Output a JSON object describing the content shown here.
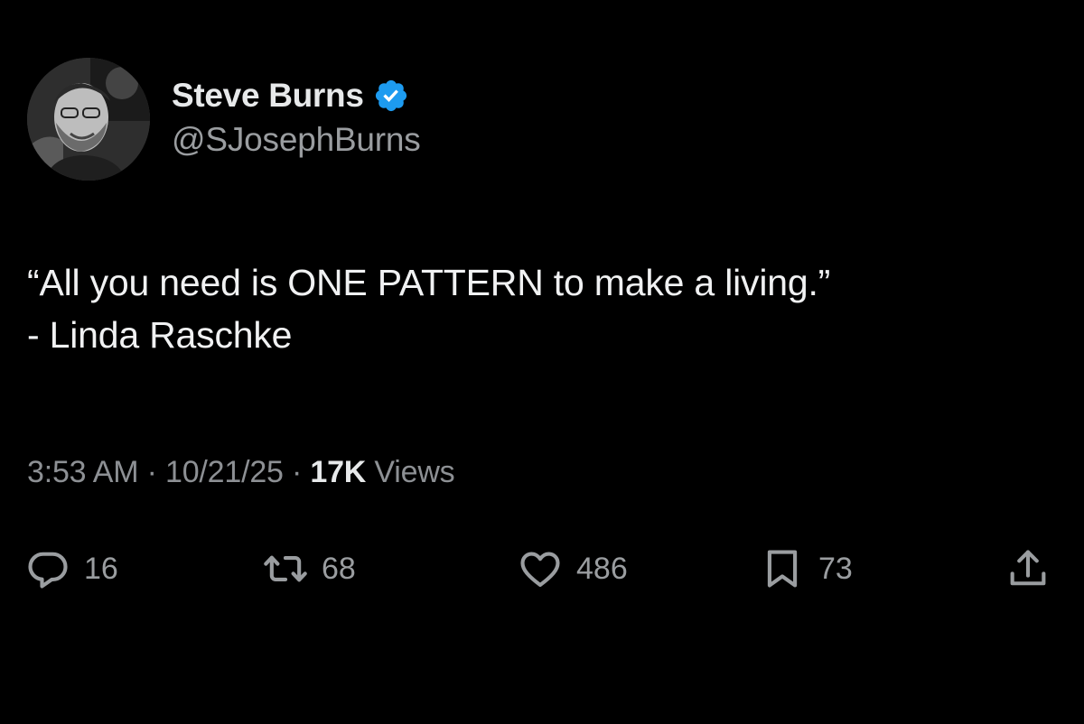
{
  "author": {
    "display_name": "Steve Burns",
    "handle": "@SJosephBurns",
    "verified": true,
    "verified_color": "#1d9bf0"
  },
  "tweet": {
    "lines": [
      "“All you need is ONE PATTERN to make a living.”",
      "- Linda Raschke"
    ]
  },
  "meta": {
    "time": "3:53 AM",
    "separator": " · ",
    "date": "10/21/25",
    "views_count": "17K",
    "views_label": " Views"
  },
  "actions": {
    "reply": {
      "count": "16",
      "icon": "reply-icon"
    },
    "repost": {
      "count": "68",
      "icon": "repost-icon"
    },
    "like": {
      "count": "486",
      "icon": "heart-icon"
    },
    "bookmark": {
      "count": "73",
      "icon": "bookmark-icon"
    },
    "share": {
      "icon": "share-icon"
    }
  },
  "colors": {
    "background": "#000000",
    "primary_text": "#e7e9ea",
    "secondary_text": "#9a9da0"
  }
}
